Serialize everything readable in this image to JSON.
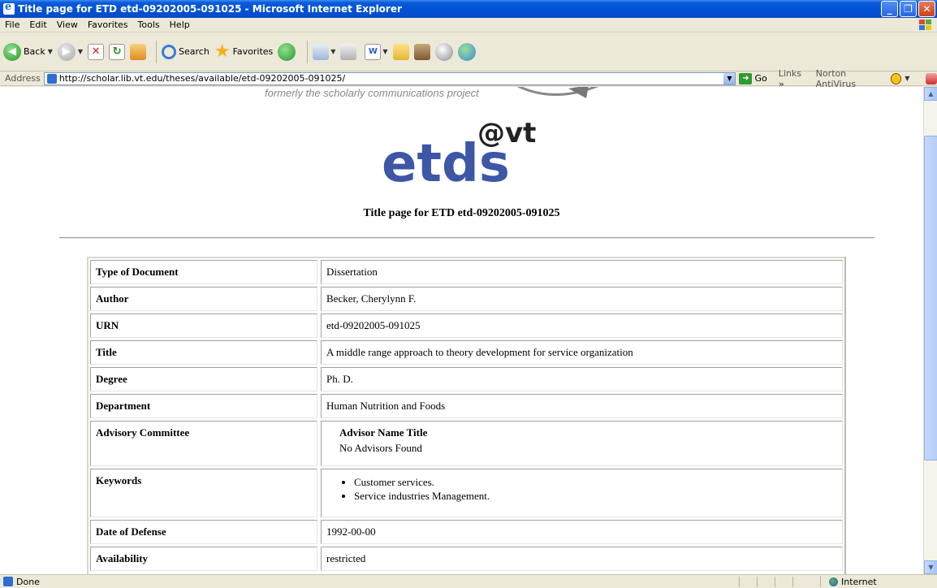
{
  "window": {
    "title": "Title page for ETD etd-09202005-091025 - Microsoft Internet Explorer"
  },
  "menu": [
    "File",
    "Edit",
    "View",
    "Favorites",
    "Tools",
    "Help"
  ],
  "toolbar": {
    "back_label": "Back",
    "search_label": "Search",
    "favorites_label": "Favorites"
  },
  "address": {
    "label": "Address",
    "url": "http://scholar.lib.vt.edu/theses/available/etd-09202005-091025/",
    "go_label": "Go",
    "links_label": "Links",
    "norton_label": "Norton AntiVirus"
  },
  "page": {
    "banner_tagline": "formerly the scholarly communications project",
    "logo_text": "etds",
    "logo_superscript": "@vt",
    "heading": "Title page for ETD etd-09202005-091025",
    "rows": [
      {
        "key": "Type of Document",
        "value": "Dissertation"
      },
      {
        "key": "Author",
        "value": "Becker, Cherylynn F."
      },
      {
        "key": "URN",
        "value": "etd-09202005-091025"
      },
      {
        "key": "Title",
        "value": "A middle range approach to theory development for service organization"
      },
      {
        "key": "Degree",
        "value": "Ph. D."
      },
      {
        "key": "Department",
        "value": "Human Nutrition and Foods"
      }
    ],
    "advisory": {
      "key": "Advisory Committee",
      "subhead": "Advisor Name Title",
      "value": "No Advisors Found"
    },
    "keywords": {
      "key": "Keywords",
      "items": [
        "Customer services.",
        "Service industries Management."
      ]
    },
    "rows_after": [
      {
        "key": "Date of Defense",
        "value": "1992-00-00"
      },
      {
        "key": "Availability",
        "value": "restricted"
      }
    ]
  },
  "status": {
    "left": "Done",
    "zone": "Internet"
  },
  "colors": {
    "titlebar": "#0052d6",
    "logo_blue": "#3d57a6",
    "logo_dark": "#222222"
  }
}
